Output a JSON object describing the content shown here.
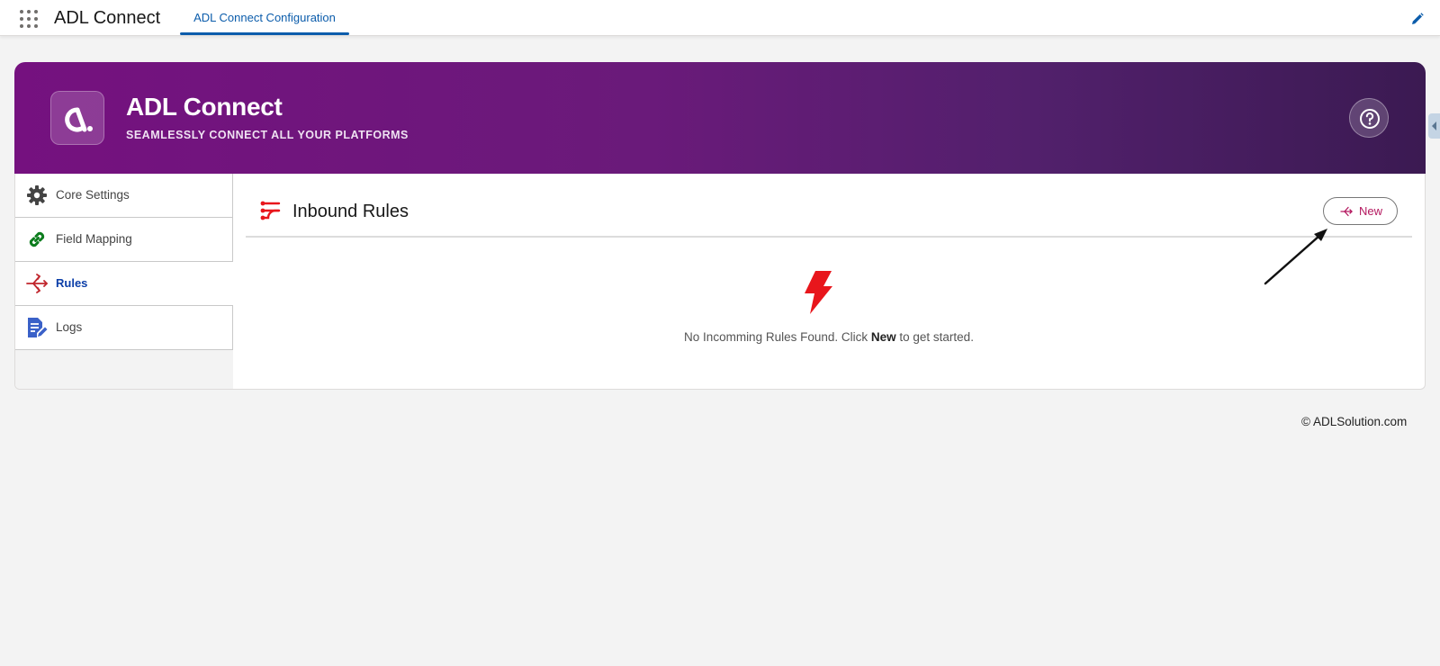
{
  "topbar": {
    "app_name": "ADL Connect",
    "tab_label": "ADL Connect Configuration"
  },
  "banner": {
    "title": "ADL Connect",
    "subtitle": "SEAMLESSLY CONNECT ALL YOUR PLATFORMS",
    "help_icon": "question-circle-icon"
  },
  "sidebar": {
    "items": [
      {
        "label": "Core Settings",
        "icon": "gear-icon",
        "active": false
      },
      {
        "label": "Field Mapping",
        "icon": "link-icon",
        "active": false
      },
      {
        "label": "Rules",
        "icon": "rules-icon",
        "active": true
      },
      {
        "label": "Logs",
        "icon": "document-edit-icon",
        "active": false
      }
    ]
  },
  "main": {
    "title": "Inbound Rules",
    "new_button_label": "New",
    "empty": {
      "before": "No Incomming Rules Found. Click ",
      "bold": "New",
      "after": " to get started."
    }
  },
  "footer": {
    "text": "© ADLSolution.com"
  },
  "colors": {
    "brand_purple": "#75117f",
    "brand_dark": "#3b1a52",
    "link_blue": "#0b5cab",
    "accent_red": "#e8161c",
    "button_accent": "#b4185f"
  }
}
